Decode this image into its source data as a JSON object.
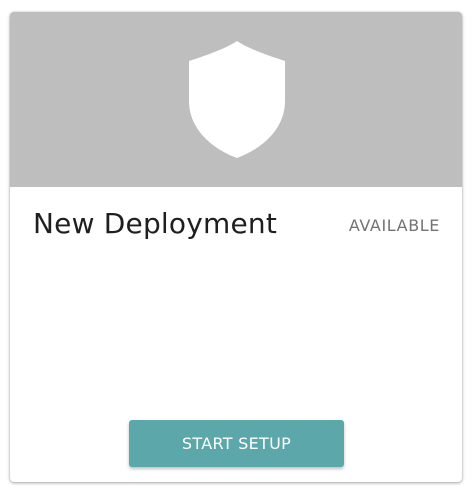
{
  "card": {
    "icon": "shield-icon",
    "title": "New Deployment",
    "status": "AVAILABLE",
    "button_label": "START SETUP"
  },
  "colors": {
    "hero_background": "#bebebe",
    "accent": "#5ba7a9",
    "icon_fill": "#ffffff"
  }
}
